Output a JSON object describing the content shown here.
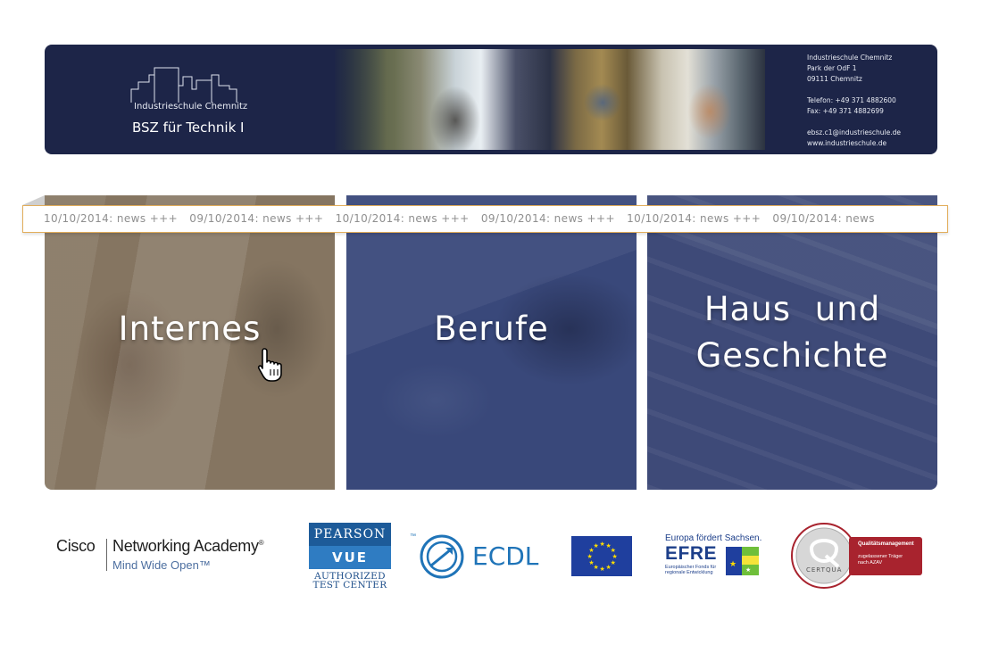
{
  "header": {
    "logo_school": "Industrieschule Chemnitz",
    "logo_title": "BSZ für Technik I",
    "contact": {
      "line1": "Industrieschule Chemnitz",
      "line2": "Park der OdF 1",
      "line3": "09111 Chemnitz",
      "phone": "Telefon: +49 371 4882600",
      "fax": "Fax: +49 371 4882699",
      "email": "ebsz.c1@industrieschule.de",
      "web": "www.industrieschule.de"
    },
    "background_color": "#1d2548"
  },
  "ticker": {
    "items": [
      "10/10/2014: news +++",
      "09/10/2014: news +++",
      "10/10/2014: news +++",
      "09/10/2014: news +++",
      "10/10/2014: news +++",
      "09/10/2014: news"
    ],
    "border_color": "#e2ad5a"
  },
  "tiles": [
    {
      "title": "Internes",
      "color": "#857561"
    },
    {
      "title": "Berufe",
      "color": "#39487a"
    },
    {
      "title_line1": "Haus und",
      "title_line2": "Geschichte",
      "color": "#3e4a78"
    }
  ],
  "partners": {
    "cisco": {
      "brand": "Cisco",
      "product": "Networking Academy",
      "registered": "®",
      "slogan": "Mind Wide Open™"
    },
    "pearson": {
      "brand": "PEARSON",
      "product": "VUE",
      "line1": "AUTHORIZED",
      "line2": "TEST CENTER"
    },
    "ecdl": {
      "tm": "™",
      "name": "ECDL"
    },
    "eu_flag": {
      "icon": "eu-flag-icon"
    },
    "efre": {
      "top": "Europa fördert Sachsen.",
      "name": "EFRE",
      "sub1": "Europäischer Fonds für",
      "sub2": "regionale Entwicklung"
    },
    "certqua": {
      "name": "CERTQUA",
      "band1": "Qualitätsmanagement",
      "band2": "zugelassener Träger",
      "band3": "nach AZAV"
    }
  }
}
